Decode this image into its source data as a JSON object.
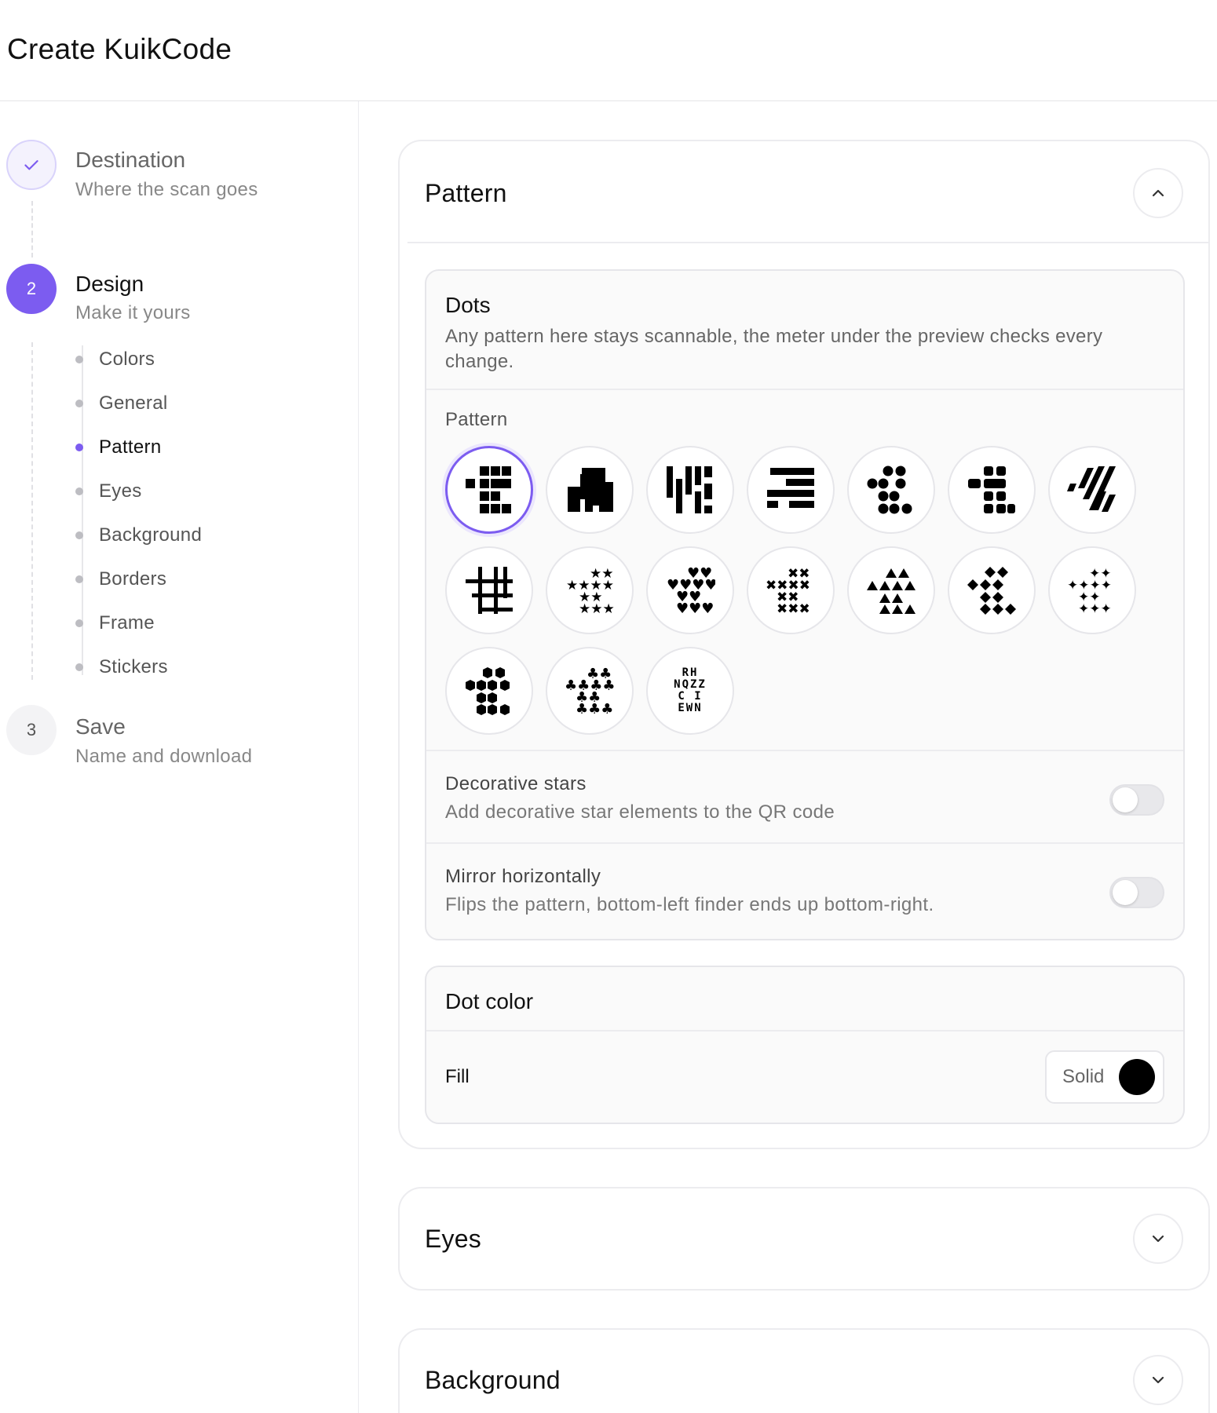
{
  "header": {
    "title": "Create KuikCode"
  },
  "steps": [
    {
      "number": "",
      "title": "Destination",
      "subtitle": "Where the scan goes",
      "status": "done"
    },
    {
      "number": "2",
      "title": "Design",
      "subtitle": "Make it yours",
      "status": "active"
    },
    {
      "number": "3",
      "title": "Save",
      "subtitle": "Name and download",
      "status": "todo"
    }
  ],
  "design_sections": [
    "Colors",
    "General",
    "Pattern",
    "Eyes",
    "Background",
    "Borders",
    "Frame",
    "Stickers"
  ],
  "active_section": "Pattern",
  "pattern_card": {
    "title": "Pattern",
    "dots": {
      "title": "Dots",
      "description": "Any pattern here stays scannable, the meter under the preview checks every change.",
      "pattern_label": "Pattern",
      "patterns": [
        "square",
        "blocks",
        "vertical-bars",
        "horizontal-bars",
        "dots",
        "rounded-squares",
        "slanted",
        "hash",
        "stars",
        "hearts",
        "crosses",
        "triangles",
        "diamonds",
        "sparkles",
        "hexagons",
        "clubs",
        "letters"
      ],
      "selected_pattern": "square",
      "letters_text": "RH\nNQZZ\nC I\nEWN"
    },
    "decorative_stars": {
      "title": "Decorative stars",
      "subtitle": "Add decorative star elements to the QR code",
      "enabled": false
    },
    "mirror": {
      "title": "Mirror horizontally",
      "subtitle": "Flips the pattern, bottom-left finder ends up bottom-right.",
      "enabled": false
    },
    "dot_color": {
      "title": "Dot color",
      "fill_label": "Fill",
      "fill_mode": "Solid",
      "color": "#000000"
    }
  },
  "collapsed_cards": {
    "eyes": "Eyes",
    "background": "Background"
  },
  "colors": {
    "accent": "#7c5cf0",
    "border": "#ececef"
  }
}
